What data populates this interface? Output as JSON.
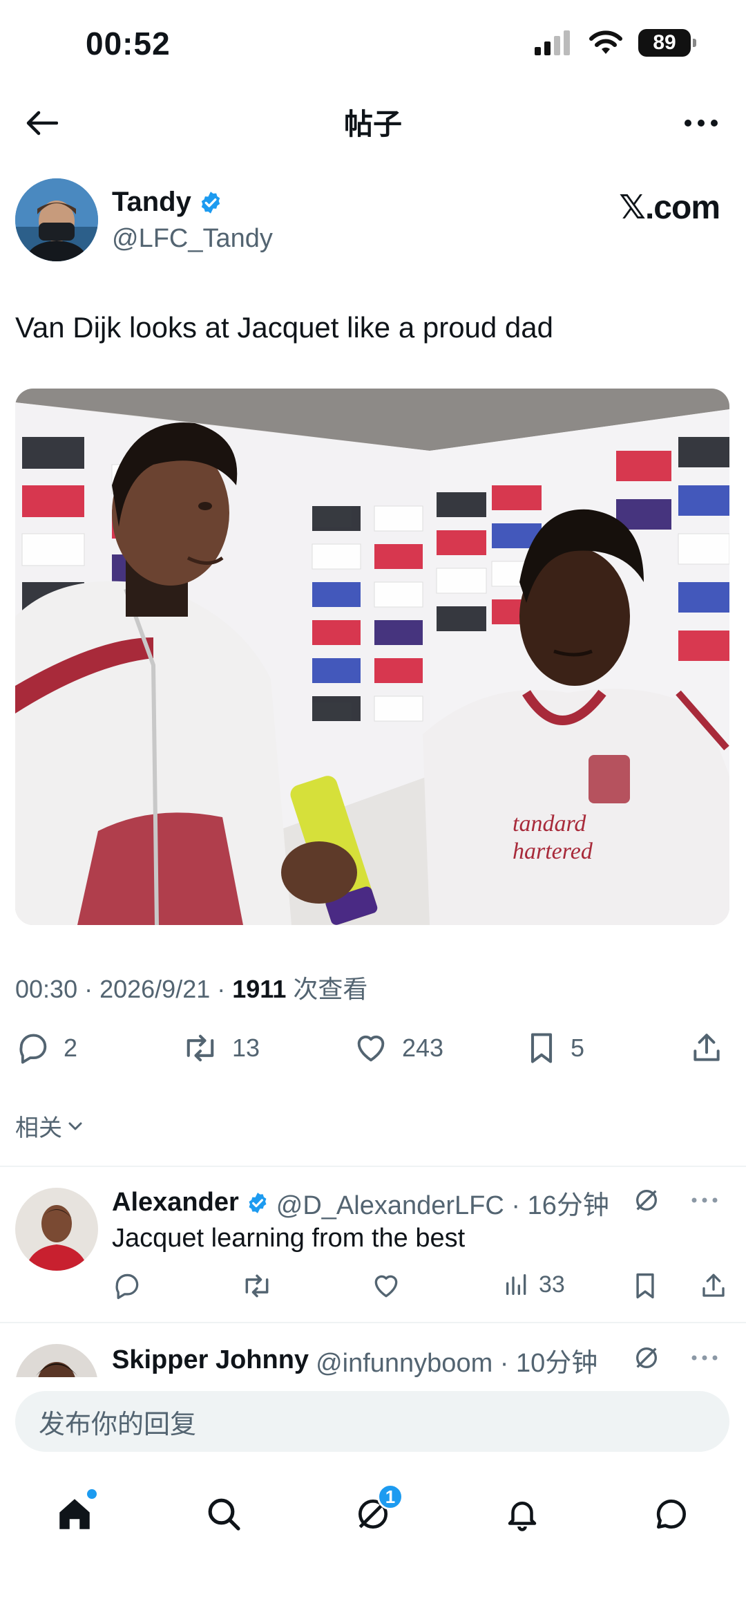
{
  "status_bar": {
    "time": "00:52",
    "battery": "89"
  },
  "header": {
    "title": "帖子"
  },
  "author": {
    "name": "Tandy",
    "handle": "@LFC_Tandy",
    "source_mark": "𝕏.com"
  },
  "tweet": {
    "text": "Van Dijk looks at Jacquet like a proud dad",
    "meta_time": "00:30 · 2026/9/21 · ",
    "views": "1911",
    "views_label": " 次查看",
    "image_alt": "Two footballers in white and red Liverpool kits being interviewed in front of a sponsor backdrop"
  },
  "actions": {
    "replies": "2",
    "reposts": "13",
    "likes": "243",
    "bookmarks": "5"
  },
  "related_label": "相关",
  "replies": [
    {
      "name": "Alexander",
      "handle": "@D_AlexanderLFC · 16分钟",
      "text": "Jacquet learning from the best",
      "views": "33"
    },
    {
      "name": "Skipper Johnny",
      "handle": "@infunnyboom · 10分钟"
    }
  ],
  "composer": {
    "placeholder": "发布你的回复"
  },
  "bottom_nav": {
    "messages_badge": "1"
  },
  "colors": {
    "accent": "#1d9bf0",
    "text": "#0f1419",
    "muted": "#536471"
  }
}
